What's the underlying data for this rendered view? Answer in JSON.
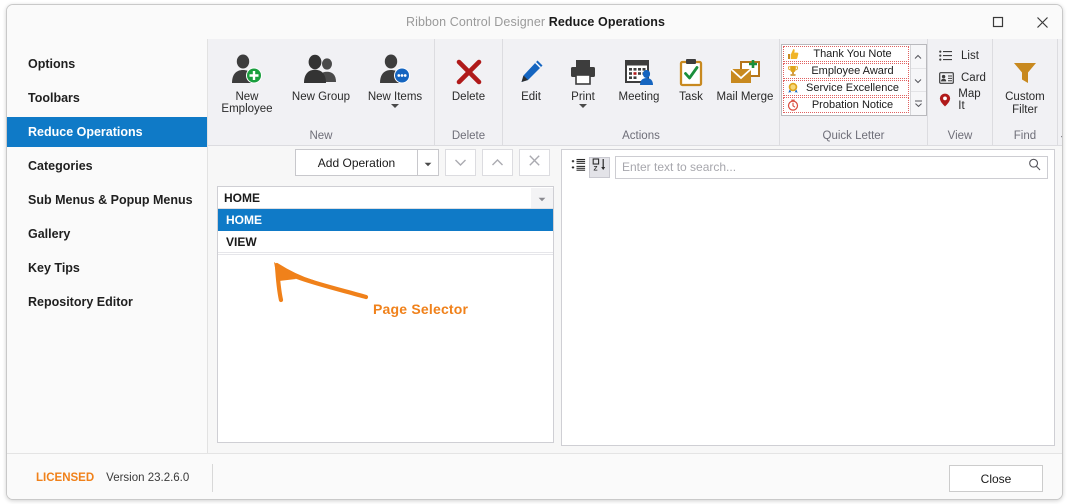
{
  "window": {
    "title_app": "Ribbon Control Designer",
    "title_page": "Reduce Operations",
    "maximize_icon": "maximize-icon",
    "close_icon": "close-icon"
  },
  "sidebar": {
    "items": [
      {
        "label": "Options",
        "active": false
      },
      {
        "label": "Toolbars",
        "active": false
      },
      {
        "label": "Reduce Operations",
        "active": true
      },
      {
        "label": "Categories",
        "active": false
      },
      {
        "label": "Sub Menus & Popup Menus",
        "active": false
      },
      {
        "label": "Gallery",
        "active": false
      },
      {
        "label": "Key Tips",
        "active": false
      },
      {
        "label": "Repository Editor",
        "active": false
      }
    ],
    "active_color": "#0f7ac7"
  },
  "ribbon": {
    "groups": [
      {
        "label": "New",
        "buttons": [
          {
            "label": "New Employee",
            "icon": "person-add-icon",
            "has_caret": false
          },
          {
            "label": "New Group",
            "icon": "people-group-icon",
            "has_caret": false
          },
          {
            "label": "New Items",
            "icon": "person-more-icon",
            "has_caret": true
          }
        ]
      },
      {
        "label": "Delete",
        "buttons": [
          {
            "label": "Delete",
            "icon": "x-cross-icon",
            "has_caret": false
          }
        ]
      },
      {
        "label": "Actions",
        "buttons": [
          {
            "label": "Edit",
            "icon": "pencil-icon",
            "has_caret": false
          },
          {
            "label": "Print",
            "icon": "printer-icon",
            "has_caret": true
          },
          {
            "label": "Meeting",
            "icon": "calendar-person-icon",
            "has_caret": false
          },
          {
            "label": "Task",
            "icon": "clipboard-check-icon",
            "has_caret": false
          },
          {
            "label": "Mail Merge",
            "icon": "envelope-plus-icon",
            "has_caret": false
          }
        ]
      },
      {
        "label": "Quick Letter",
        "gallery": [
          {
            "label": "Thank You Note",
            "icon": "thumbs-up-icon"
          },
          {
            "label": "Employee Award",
            "icon": "trophy-icon"
          },
          {
            "label": "Service Excellence",
            "icon": "medal-icon"
          },
          {
            "label": "Probation Notice",
            "icon": "clock-icon"
          }
        ],
        "scroll_buttons": [
          "scroll-up-icon",
          "scroll-down-icon",
          "gallery-expand-icon"
        ]
      },
      {
        "label": "View",
        "small_buttons": [
          {
            "label": "List",
            "icon": "list-icon"
          },
          {
            "label": "Card",
            "icon": "card-icon"
          },
          {
            "label": "Map It",
            "icon": "map-pin-icon"
          }
        ]
      },
      {
        "label": "Find",
        "buttons": [
          {
            "label": "Custom\nFilter",
            "label_line1": "Custom",
            "label_line2": "Filter",
            "icon": "funnel-icon",
            "has_caret": false
          }
        ]
      }
    ],
    "collapse_icon": "chevron-up-icon"
  },
  "operations": {
    "add_button_label": "Add Operation",
    "add_button_caret_icon": "caret-down-icon",
    "move_down_icon": "chevron-down-icon",
    "move_up_icon": "chevron-up-icon",
    "remove_icon": "close-x-icon",
    "combo": {
      "value": "HOME",
      "caret_icon": "caret-down-icon",
      "options": [
        {
          "label": "HOME",
          "selected": true
        },
        {
          "label": "VIEW",
          "selected": false
        }
      ]
    }
  },
  "properties": {
    "group_icon": "group-by-icon",
    "sort_icon": "sort-az-icon",
    "search_placeholder": "Enter text to search...",
    "search_value": "",
    "search_icon": "magnifier-icon"
  },
  "annotation": {
    "label": "Page Selector",
    "color": "#f0811a",
    "arrow_icon": "curved-arrow-icon"
  },
  "footer": {
    "licensed_label": "LICENSED",
    "version": "Version 23.2.6.0",
    "close_label": "Close"
  }
}
